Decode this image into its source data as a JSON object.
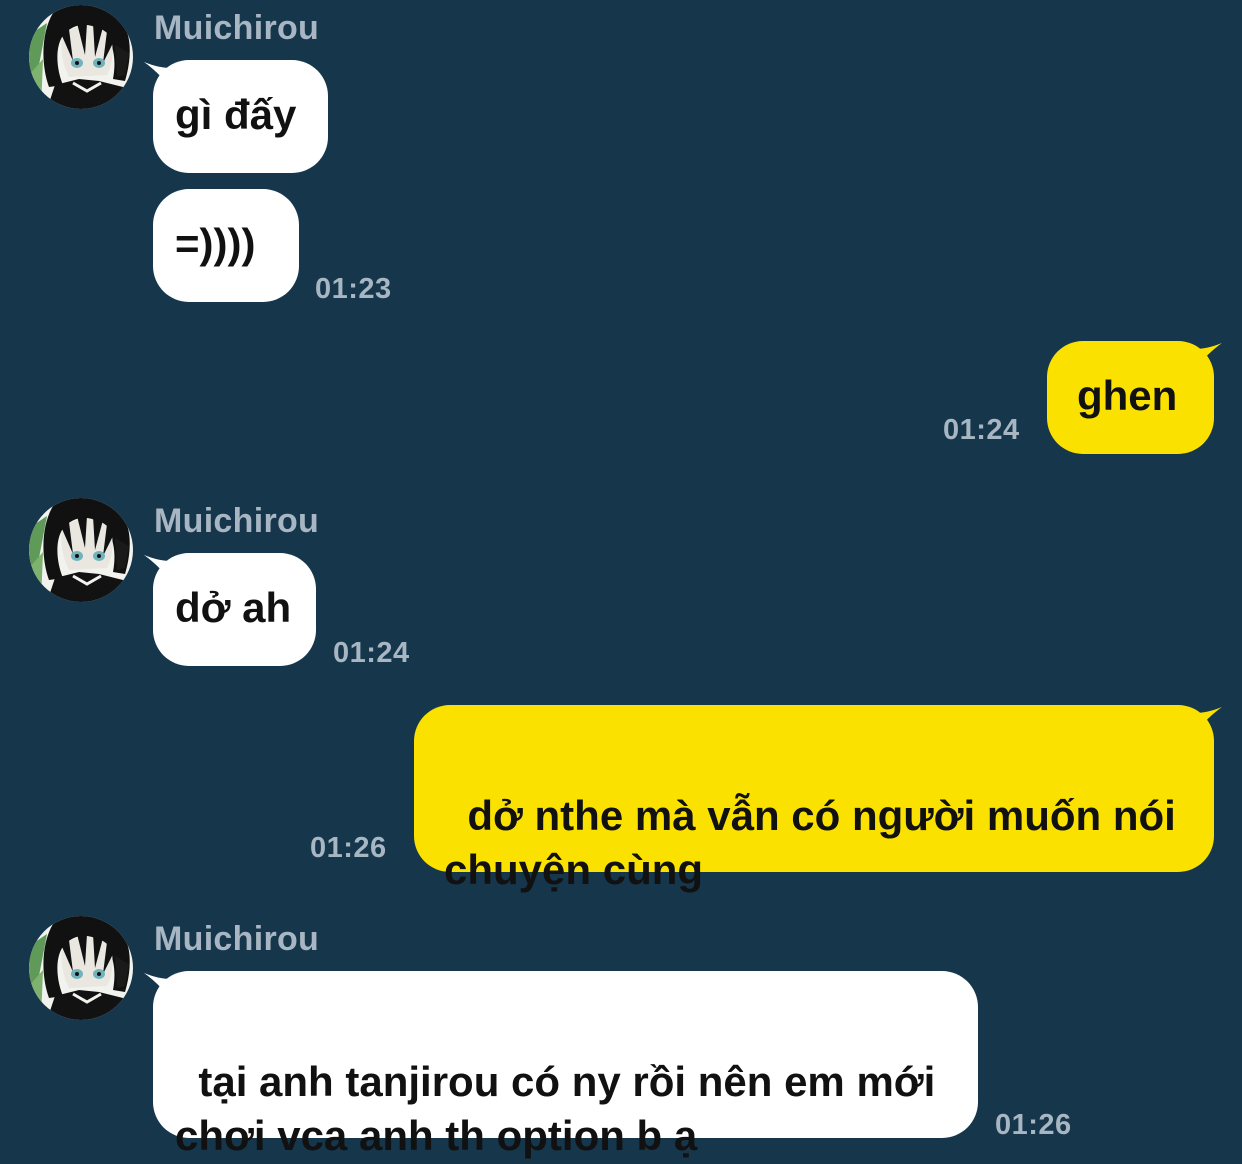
{
  "chat": {
    "colors": {
      "background": "#15364b",
      "incoming_bubble": "#ffffff",
      "outgoing_bubble": "#fbe100",
      "meta_text": "#a7b6c2"
    },
    "contact_name": "Muichirou",
    "groups": [
      {
        "sender": "Muichirou",
        "messages": [
          "gì đấy",
          "=))))"
        ],
        "time": "01:23"
      },
      {
        "messages": [
          "ghen"
        ],
        "time": "01:24"
      },
      {
        "sender": "Muichirou",
        "messages": [
          "dở ah"
        ],
        "time": "01:24"
      },
      {
        "messages": [
          "dở nthe mà vẫn có người muốn nói\nchuyện cùng"
        ],
        "time": "01:26"
      },
      {
        "sender": "Muichirou",
        "messages": [
          "tại anh tanjirou có ny rồi nên em mới\nchơi vca anh th option b ạ"
        ],
        "time": "01:26"
      }
    ]
  }
}
